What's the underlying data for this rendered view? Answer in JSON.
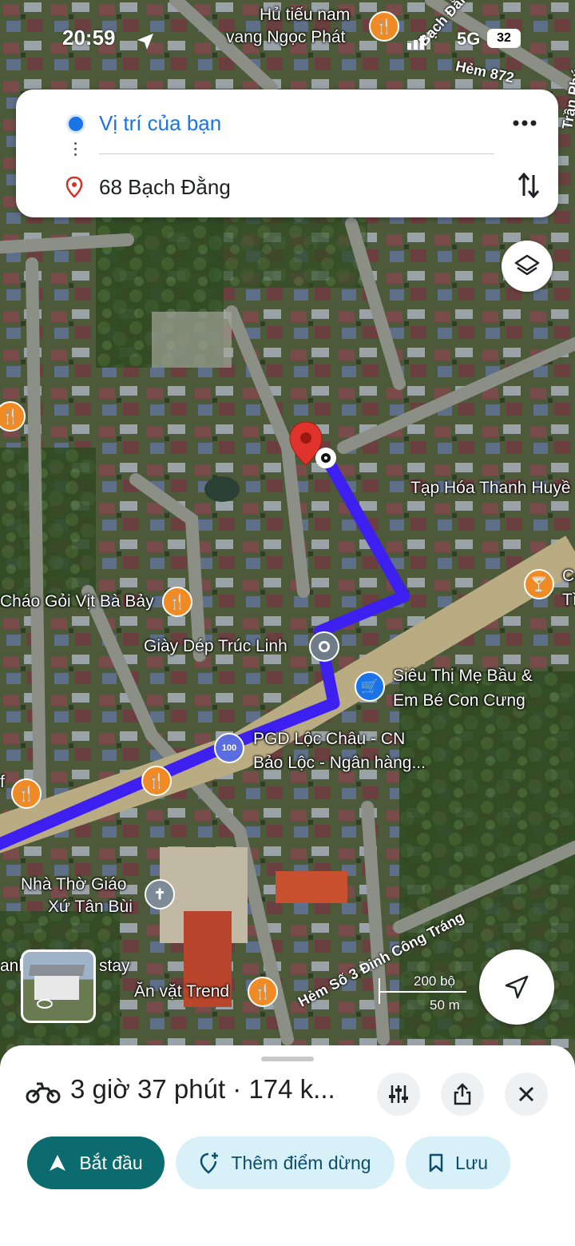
{
  "status_bar": {
    "time": "20:59",
    "network": "5G",
    "battery": "32"
  },
  "directions": {
    "origin": "Vị trí của bạn",
    "destination": "68 Bạch Đằng",
    "more_icon": "more-vert-icon",
    "swap_icon": "swap-vertical-icon"
  },
  "map": {
    "labels": {
      "hu_tieu_1": "Hủ tiếu nam",
      "hu_tieu_2": "vang Ngọc Phát",
      "tap_hoa": "Tạp Hóa Thanh Huyề",
      "chao_goi": "Cháo Gỏi Vịt Bà Bảy",
      "giay_dep": "Giày Dép Trúc Linh",
      "sieu_thi_1": "Siêu Thị Mẹ Bầu &",
      "sieu_thi_2": "Em Bé Con Cưng",
      "pgd_1": "PGD Lộc Châu - CN",
      "pgd_2": "Bảo Lộc - Ngân hàng...",
      "nha_tho_1": "Nhà Thờ Giáo",
      "nha_tho_2": "Xứ Tân Bùi",
      "an_vat": "Ăn vặt Trend",
      "homestay": "anh",
      "homestay_2": "stay",
      "c_label": "C",
      "t_label": "Tì",
      "f_label": "f"
    },
    "roads": {
      "bach_dang": "Bạch Đằng",
      "hem_872": "Hẻm 872",
      "tran_phu": "Trần Phú",
      "hem_so_3": "Hẻm Số 3 Đinh Công Tráng"
    },
    "scale": {
      "top": "200 bộ",
      "bottom": "50 m"
    },
    "route_color": "#3d1ff0",
    "layers_icon": "layers-icon",
    "recenter_icon": "navigation-arrow-icon",
    "street_view_icon": "street-view-thumbnail"
  },
  "bottom_sheet": {
    "vehicle_icon": "motorbike-icon",
    "summary": "3 giờ 37 phút · 174 k...",
    "options_icon": "tune-icon",
    "share_icon": "share-icon",
    "close_icon": "close-icon",
    "start_label": "Bắt đầu",
    "add_stop_label": "Thêm điểm dừng",
    "save_label": "Lưu"
  }
}
